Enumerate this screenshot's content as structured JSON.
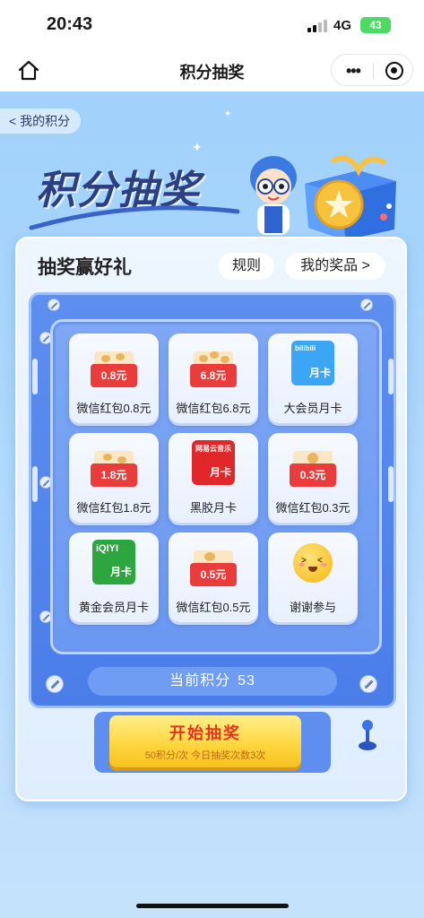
{
  "status_bar": {
    "time": "20:43",
    "network": "4G",
    "battery": "43"
  },
  "nav": {
    "title": "积分抽奖"
  },
  "hero": {
    "back_label": "< 我的积分",
    "title": "积分抽奖"
  },
  "card": {
    "heading": "抽奖赢好礼",
    "rules_label": "规则",
    "prizes_label": "我的奖品 >"
  },
  "prizes": [
    {
      "label": "微信红包0.8元",
      "amount": "0.8元",
      "kind": "envelope"
    },
    {
      "label": "微信红包6.8元",
      "amount": "6.8元",
      "kind": "envelope"
    },
    {
      "label": "大会员月卡",
      "card_text": "月卡",
      "brand": "bilibili",
      "kind": "card",
      "color": "#3aa6f5"
    },
    {
      "label": "微信红包1.8元",
      "amount": "1.8元",
      "kind": "envelope"
    },
    {
      "label": "黑胶月卡",
      "card_text": "月卡",
      "brand": "网易云音乐",
      "kind": "card",
      "color": "#e0282a"
    },
    {
      "label": "微信红包0.3元",
      "amount": "0.3元",
      "kind": "envelope"
    },
    {
      "label": "黄金会员月卡",
      "card_text": "月卡",
      "brand": "iQIYI",
      "kind": "card",
      "color": "#2ea640"
    },
    {
      "label": "微信红包0.5元",
      "amount": "0.5元",
      "kind": "envelope"
    },
    {
      "label": "谢谢参与",
      "kind": "emoji"
    }
  ],
  "points": {
    "label": "当前积分",
    "value": "53"
  },
  "draw": {
    "button_label": "开始抽奖",
    "sub_label": "50积分/次 今日抽奖次数3次"
  }
}
